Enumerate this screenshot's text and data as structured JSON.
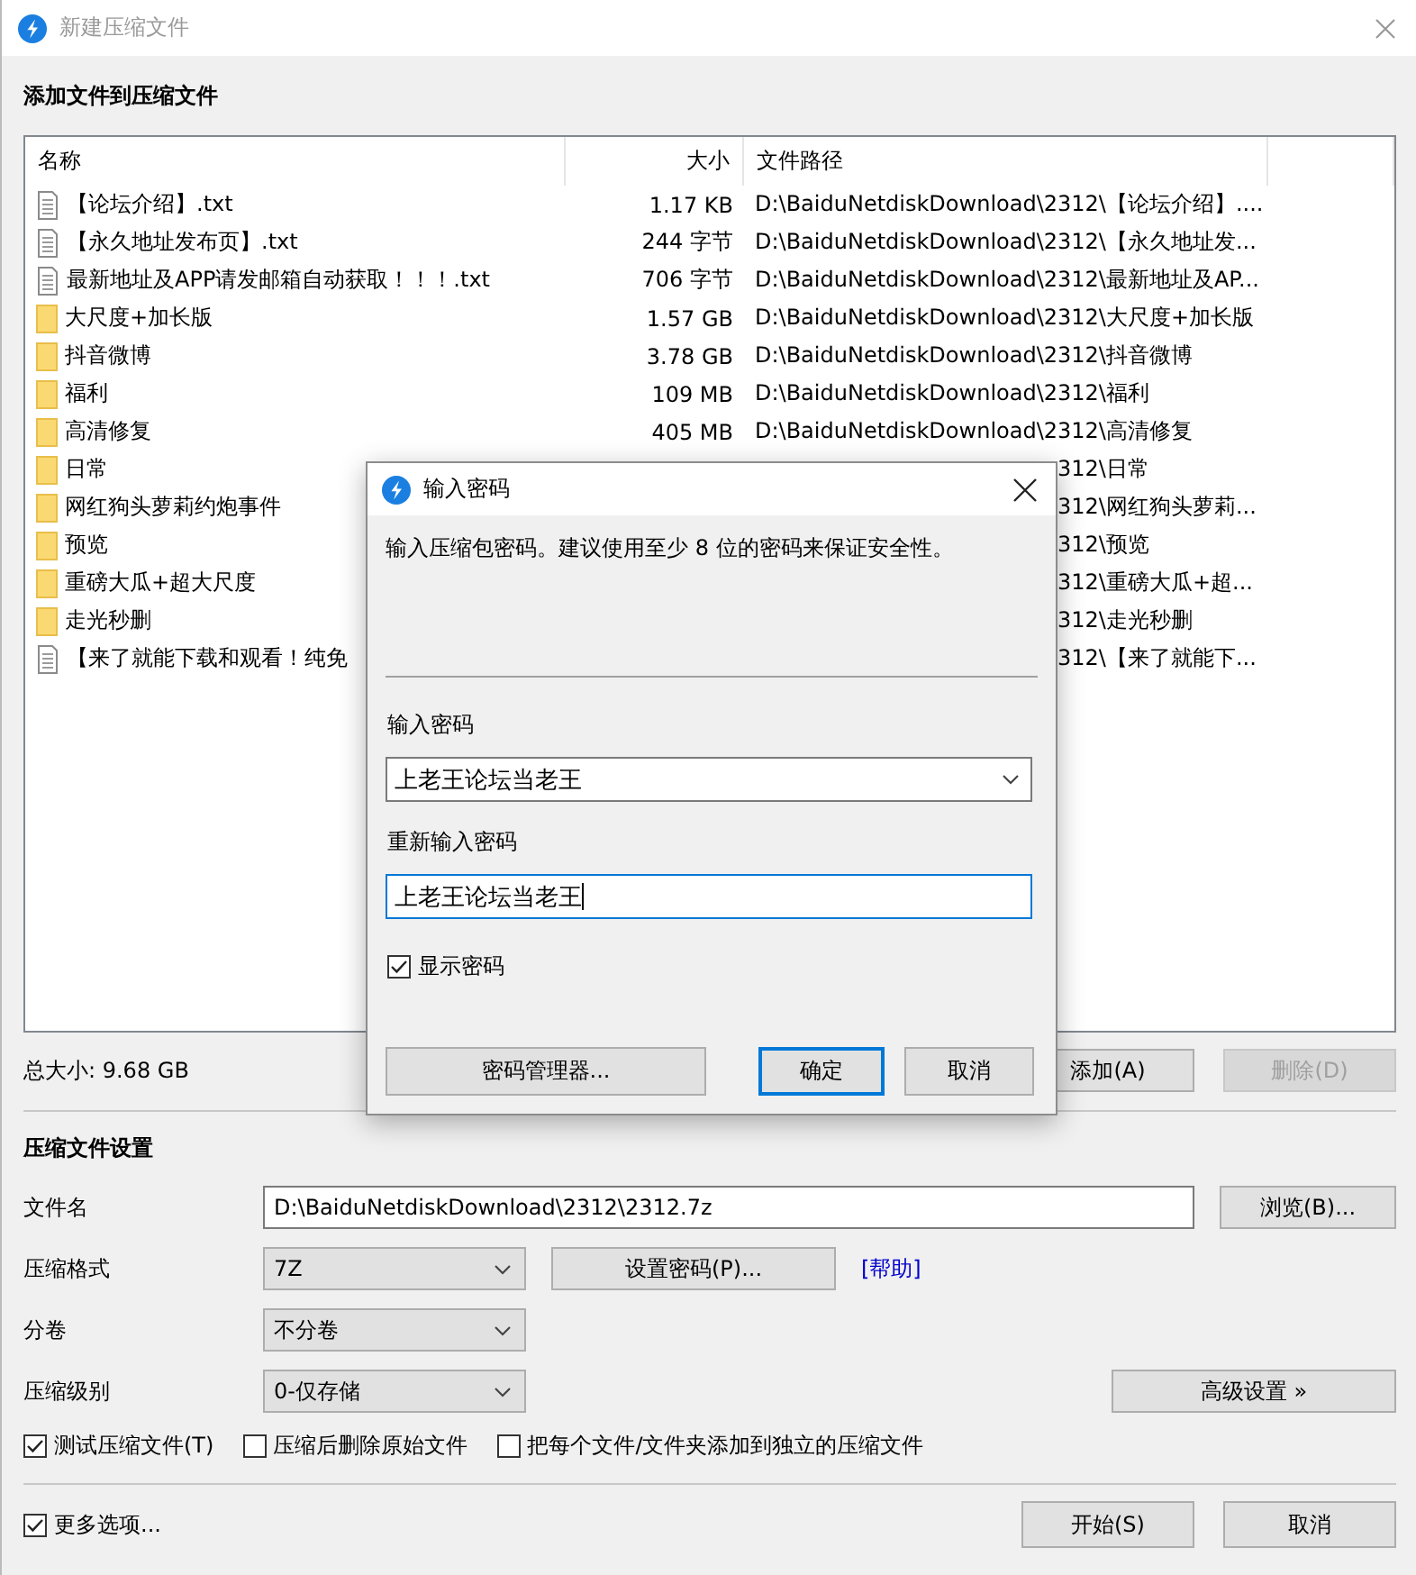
{
  "window": {
    "title": "新建压缩文件"
  },
  "files": {
    "heading": "添加文件到压缩文件",
    "columns": [
      "名称",
      "大小",
      "文件路径"
    ],
    "rows": [
      {
        "kind": "file",
        "name": "【论坛介绍】.txt",
        "size": "1.17 KB",
        "path": "D:\\BaiduNetdiskDownload\\2312\\【论坛介绍】...."
      },
      {
        "kind": "file",
        "name": "【永久地址发布页】.txt",
        "size": "244 字节",
        "path": "D:\\BaiduNetdiskDownload\\2312\\【永久地址发..."
      },
      {
        "kind": "file",
        "name": "最新地址及APP请发邮箱自动获取！！！.txt",
        "size": "706 字节",
        "path": "D:\\BaiduNetdiskDownload\\2312\\最新地址及AP..."
      },
      {
        "kind": "folder",
        "name": "大尺度+加长版",
        "size": "1.57 GB",
        "path": "D:\\BaiduNetdiskDownload\\2312\\大尺度+加长版"
      },
      {
        "kind": "folder",
        "name": "抖音微博",
        "size": "3.78 GB",
        "path": "D:\\BaiduNetdiskDownload\\2312\\抖音微博"
      },
      {
        "kind": "folder",
        "name": "福利",
        "size": "109 MB",
        "path": "D:\\BaiduNetdiskDownload\\2312\\福利"
      },
      {
        "kind": "folder",
        "name": "高清修复",
        "size": "405 MB",
        "path": "D:\\BaiduNetdiskDownload\\2312\\高清修复"
      },
      {
        "kind": "folder",
        "name": "日常",
        "path": "312\\日常"
      },
      {
        "kind": "folder",
        "name": "网红狗头萝莉约炮事件",
        "path": "312\\网红狗头萝莉..."
      },
      {
        "kind": "folder",
        "name": "预览",
        "path": "312\\预览"
      },
      {
        "kind": "folder",
        "name": "重磅大瓜+超大尺度",
        "path": "312\\重磅大瓜+超..."
      },
      {
        "kind": "folder",
        "name": "走光秒删",
        "path": "312\\走光秒删"
      },
      {
        "kind": "file",
        "name": "【来了就能下载和观看！纯免",
        "path": "312\\【来了就能下..."
      }
    ],
    "total": "总大小: 9.68 GB",
    "buttons": [
      {
        "label": "添加(A)",
        "disabled": false
      },
      {
        "label": "删除(D)",
        "disabled": true
      }
    ]
  },
  "settings": {
    "heading": "压缩文件设置",
    "filename": {
      "label": "文件名",
      "value": "D:\\BaiduNetdiskDownload\\2312\\2312.7z",
      "button": "浏览(B)..."
    },
    "format": {
      "label": "压缩格式",
      "value": "7Z",
      "button": "设置密码(P)...",
      "link": "[帮助]"
    },
    "volume": {
      "label": "分卷",
      "value": "不分卷"
    },
    "level": {
      "label": "压缩级别",
      "value": "0-仅存储",
      "button": "高级设置 »"
    },
    "options": [
      {
        "label": "测试压缩文件(T)",
        "checked": true
      },
      {
        "label": "压缩后删除原始文件",
        "checked": false
      },
      {
        "label": "把每个文件/文件夹添加到独立的压缩文件",
        "checked": false
      }
    ]
  },
  "footer": {
    "more_options": {
      "label": "更多选项...",
      "checked": true
    },
    "buttons": [
      "开始(S)",
      "取消"
    ]
  },
  "password_dialog": {
    "title": "输入密码",
    "description": "输入压缩包密码。建议使用至少 8 位的密码来保证安全性。",
    "password_label": "输入密码",
    "password_value": "上老王论坛当老王",
    "confirm_label": "重新输入密码",
    "confirm_value": "上老王论坛当老王",
    "show_password": {
      "label": "显示密码",
      "checked": true
    },
    "buttons": [
      {
        "label": "密码管理器...",
        "default": false
      },
      {
        "label": "确定",
        "default": true
      },
      {
        "label": "取消",
        "default": false
      }
    ]
  }
}
